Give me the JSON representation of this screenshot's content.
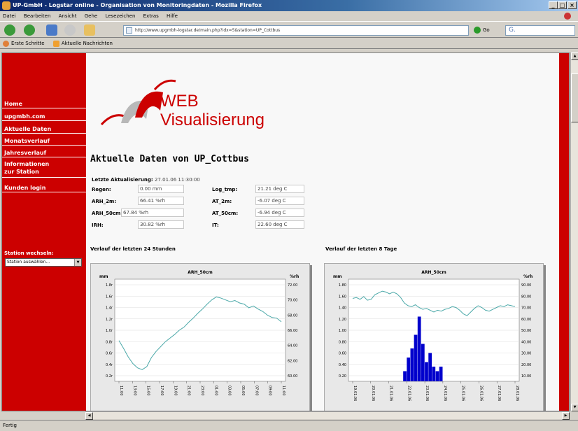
{
  "window": {
    "title": "UP-GmbH - Logstar online - Organisation von Monitoringdaten - Mozilla Firefox",
    "controls": [
      "_",
      "□",
      "×"
    ]
  },
  "menu": [
    "Datei",
    "Bearbeiten",
    "Ansicht",
    "Gehe",
    "Lesezeichen",
    "Extras",
    "Hilfe"
  ],
  "toolbar": {
    "url": "http://www.upgmbh-logstar.de/main.php?idx=5&station=UP_Cottbus",
    "go_label": "Go",
    "search_icon": "search-icon"
  },
  "bookmarks": [
    {
      "label": "Erste Schritte",
      "icon": "firefox-icon"
    },
    {
      "label": "Aktuelle Nachrichten",
      "icon": "rss-icon"
    }
  ],
  "sidebar": {
    "items": [
      {
        "label": "Home"
      },
      {
        "label": "upgmbh.com"
      },
      {
        "label": "Aktuelle Daten"
      },
      {
        "label": "Monatsverlauf"
      },
      {
        "label": "Jahresverlauf"
      },
      {
        "label": "Informationen zur Station"
      },
      {
        "label": "Kunden login"
      }
    ],
    "station_label": "Station wechseln:",
    "station_select": "Station auswählen..."
  },
  "logo": {
    "line1": "WEB",
    "line2": "Visualisierung"
  },
  "page_title": "Aktuelle Daten von UP_Cottbus",
  "last_update": {
    "label": "Letzte Aktualisierung:",
    "value": "27.01.06 11:30:00"
  },
  "measurements": {
    "left": [
      {
        "label": "Regen:",
        "value": "0.00 mm"
      },
      {
        "label": "ARH_2m:",
        "value": "66.41 %rh"
      },
      {
        "label": "ARH_50cm:",
        "value": "67.84 %rh"
      },
      {
        "label": "IRH:",
        "value": "30.82 %rh"
      }
    ],
    "right": [
      {
        "label": "Log_tmp:",
        "value": "21.21 deg C"
      },
      {
        "label": "AT_2m:",
        "value": "-6.07 deg C"
      },
      {
        "label": "AT_50cm:",
        "value": "-6.94 deg C"
      },
      {
        "label": "IT:",
        "value": "22.60 deg C"
      }
    ]
  },
  "section_titles": {
    "chart24h": "Verlauf der letzten 24 Stunden",
    "chart8d": "Verlauf der letzten 8 Tage"
  },
  "status": "Fertig",
  "colors": {
    "brand": "#cc0000",
    "line": "#4aa8a8",
    "bar": "#0000cc"
  },
  "chart_data": [
    {
      "type": "line",
      "title": "ARH_50cm",
      "ylabel": "mm",
      "y2label": "%rh",
      "y_ticks": [
        "0.20",
        "0.40",
        "0.60",
        "0.80",
        "1.00",
        "1.20",
        "1.40",
        "1.60",
        "1.80"
      ],
      "y_ticks_display": [
        "0.2r",
        "0.4r",
        "0.6r",
        "0.8r",
        "1.0r",
        "1.2r",
        "1.4r",
        "1.6r",
        "1.8r"
      ],
      "y2_ticks": [
        "60.00",
        "62.00",
        "64.00",
        "66.00",
        "68.00",
        "70.00",
        "72.00"
      ],
      "y2lim": [
        59,
        74
      ],
      "x_ticks": [
        "11:00",
        "13:00",
        "15:00",
        "17:00",
        "19:00",
        "21:00",
        "23:00",
        "01:00",
        "03:00",
        "05:00",
        "07:00",
        "09:00",
        "11:00"
      ],
      "series": [
        {
          "values": [
            64.8,
            63.5,
            62.1,
            61.0,
            60.3,
            60.0,
            60.5,
            62.0,
            63.0,
            63.8,
            64.6,
            65.2,
            65.8,
            66.5,
            67.0,
            67.8,
            68.5,
            69.3,
            70.0,
            70.8,
            71.5,
            72.0,
            71.8,
            71.5,
            71.2,
            71.4,
            71.0,
            70.8,
            70.2,
            70.5,
            70.0,
            69.6,
            69.0,
            68.6,
            68.5,
            67.9
          ]
        }
      ]
    },
    {
      "type": "line",
      "title": "ARH_50cm",
      "ylabel": "mm",
      "y2label": "%rh",
      "y_ticks": [
        "0.20",
        "0.40",
        "0.60",
        "0.80",
        "1.00",
        "1.20",
        "1.40",
        "1.60",
        "1.80"
      ],
      "y2_ticks": [
        "10.00",
        "20.00",
        "30.00",
        "40.00",
        "50.00",
        "60.00",
        "70.00",
        "80.00",
        "90.00"
      ],
      "y2lim": [
        0,
        100
      ],
      "ylim": [
        0,
        2
      ],
      "x_ticks": [
        "19.01.06",
        "20.01.06",
        "21.01.06",
        "22.01.06",
        "23.01.06",
        "24.01.06",
        "25.01.06",
        "26.01.06",
        "27.01.06",
        "28.01.06"
      ],
      "series": [
        {
          "name": "ARH_50cm",
          "values": [
            85,
            86,
            84,
            87,
            83,
            84,
            89,
            91,
            93,
            92,
            90,
            92,
            90,
            86,
            80,
            77,
            76,
            78,
            75,
            73,
            74,
            72,
            70,
            72,
            71,
            73,
            74,
            76,
            75,
            72,
            68,
            66,
            70,
            74,
            77,
            75,
            72,
            71,
            73,
            75,
            77,
            76,
            78,
            77,
            76
          ]
        },
        {
          "name": "Regen",
          "type": "bar",
          "values": [
            0,
            0,
            0,
            0,
            0,
            0,
            0,
            0,
            0,
            0,
            0,
            0,
            0,
            0,
            0.1,
            0.4,
            0.6,
            0.9,
            1.3,
            0.7,
            0.3,
            0.5,
            0.2,
            0.1,
            0.2,
            0,
            0,
            0,
            0,
            0,
            0,
            0,
            0,
            0,
            0,
            0,
            0,
            0,
            0,
            0,
            0,
            0,
            0,
            0,
            0
          ]
        }
      ]
    }
  ]
}
